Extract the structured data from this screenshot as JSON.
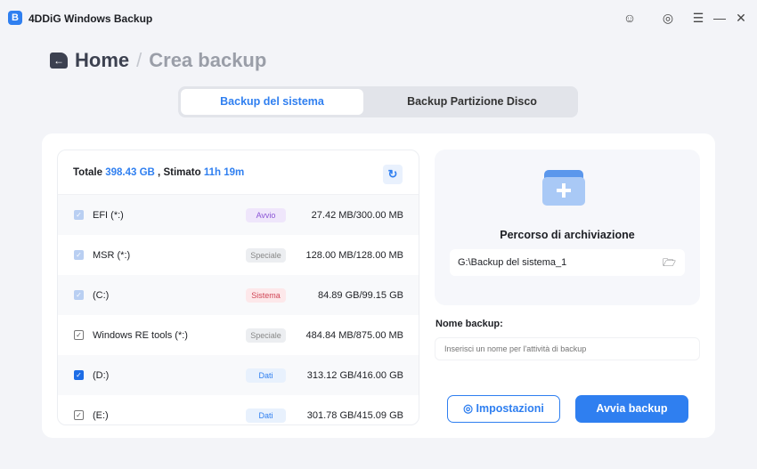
{
  "app": {
    "title": "4DDiG Windows Backup",
    "logo": "B"
  },
  "window_icons": [
    "user-icon",
    "settings-icon",
    "menu-icon",
    "minimize-icon",
    "close-icon"
  ],
  "breadcrumb": {
    "home": "Home",
    "separator": "/",
    "current": "Crea backup"
  },
  "tabs": [
    {
      "label": "Backup del sistema",
      "active": true
    },
    {
      "label": "Backup Partizione Disco",
      "active": false
    }
  ],
  "summary": {
    "total_label": "Totale",
    "total": "398.43 GB",
    "sep": ",",
    "est_label": "Stimato",
    "est": "11h 19m"
  },
  "partitions": [
    {
      "name": "EFI (*:)",
      "badge": "Avvio",
      "size": "27.42 MB/300.00 MB",
      "checked": true,
      "disabled": true
    },
    {
      "name": "MSR (*:)",
      "badge": "Speciale",
      "size": "128.00 MB/128.00 MB",
      "checked": true,
      "disabled": true
    },
    {
      "name": " (C:)",
      "badge": "Sistema",
      "size": "84.89 GB/99.15 GB",
      "checked": true,
      "disabled": true
    },
    {
      "name": "Windows RE tools (*:)",
      "badge": "Speciale",
      "size": "484.84 MB/875.00 MB",
      "checked": true,
      "disabled": false
    },
    {
      "name": " (D:)",
      "badge": "Dati",
      "size": "313.12 GB/416.00 GB",
      "checked": true,
      "disabled": false
    },
    {
      "name": " (E:)",
      "badge": "Dati",
      "size": "301.78 GB/415.09 GB",
      "checked": true,
      "disabled": false
    }
  ],
  "destination": {
    "title": "Percorso di archiviazione",
    "path": "G:\\Backup del sistema_1"
  },
  "name_field": {
    "label": "Nome backup:",
    "placeholder": "Inserisci un nome per l'attività di backup",
    "value": ""
  },
  "buttons": {
    "settings": "Impostazioni",
    "start": "Avvia backup"
  },
  "colors": {
    "accent": "#2f7ff0"
  }
}
